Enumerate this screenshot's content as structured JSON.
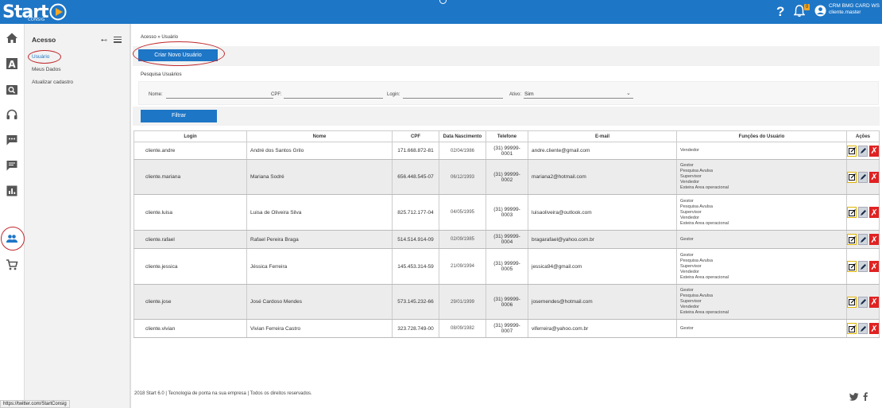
{
  "header": {
    "logo_text": "Start",
    "logo_sub": "CONSIG",
    "help_label": "?",
    "notification_count": "0",
    "user_company": "CRM BMG CARD WS",
    "user_login": "cliente.master",
    "brand_color": "#1e76c6"
  },
  "submenu": {
    "title": "Acesso",
    "items": [
      "Usuário",
      "Meus Dados",
      "Atualizar cadastro"
    ]
  },
  "status_url": "https://twitter.com/StartConsig",
  "breadcrumb": "Acesso » Usuário",
  "create_button": "Criar Novo Usuário",
  "search": {
    "title": "Pesquisa Usuários",
    "nome_label": "Nome:",
    "cpf_label": "CPF:",
    "login_label": "Login:",
    "ativo_label": "Ativo:",
    "ativo_value": "Sim",
    "filter_button": "Filtrar"
  },
  "table": {
    "headers": [
      "Login",
      "Nome",
      "CPF",
      "Data Nascimento",
      "Telefone",
      "E-mail",
      "Funções do Usuário",
      "Ações"
    ],
    "rows": [
      {
        "login": "cliente.andre",
        "nome": "André dos Santos Grilo",
        "cpf": "171.668.872-81",
        "nascimento": "02/04/1986",
        "telefone": "(31) 99999-0001",
        "email": "andre.cliente@gmail.com",
        "funcoes": [
          "Vendedor"
        ]
      },
      {
        "login": "cliente.mariana",
        "nome": "Mariana Sodré",
        "cpf": "656.448.545-07",
        "nascimento": "06/12/1993",
        "telefone": "(31) 99999-0002",
        "email": "mariana2@hotmail.com",
        "funcoes": [
          "Gestor",
          "Pesquisa Avulsa",
          "Supervisor",
          "Vendedor",
          "Esteira Area operacional"
        ]
      },
      {
        "login": "cliente.luisa",
        "nome": "Luisa de Oliveira Silva",
        "cpf": "825.712.177-04",
        "nascimento": "04/05/1995",
        "telefone": "(31) 99999-0003",
        "email": "luisaoliveira@outlook.com",
        "funcoes": [
          "Gestor",
          "Pesquisa Avulsa",
          "Supervisor",
          "Vendedor",
          "Esteira Area operacional"
        ]
      },
      {
        "login": "cliente.rafael",
        "nome": "Rafael Pereira Braga",
        "cpf": "514.514.914-09",
        "nascimento": "02/09/1985",
        "telefone": "(31) 99999-0004",
        "email": "bragarafael@yahoo.com.br",
        "funcoes": [
          "Gestor"
        ]
      },
      {
        "login": "cliente.jessica",
        "nome": "Jéssica Ferreira",
        "cpf": "145.453.314-59",
        "nascimento": "21/09/1994",
        "telefone": "(31) 99999-0005",
        "email": "jessica94@gmail.com",
        "funcoes": [
          "Gestor",
          "Pesquisa Avulsa",
          "Supervisor",
          "Vendedor",
          "Esteira Area operacional"
        ]
      },
      {
        "login": "cliente.jose",
        "nome": "José Cardoso Mendes",
        "cpf": "573.145.232-66",
        "nascimento": "29/01/1999",
        "telefone": "(31) 99999-0006",
        "email": "josemendes@hotmail.com",
        "funcoes": [
          "Gestor",
          "Pesquisa Avulsa",
          "Supervisor",
          "Vendedor",
          "Esteira Area operacional"
        ]
      },
      {
        "login": "cliente.vivian",
        "nome": "Vivian Ferreira Castro",
        "cpf": "323.728.749-00",
        "nascimento": "08/09/1982",
        "telefone": "(31) 99999-0007",
        "email": "viferreira@yahoo.com.br",
        "funcoes": [
          "Gestor"
        ]
      }
    ]
  },
  "footer": "2018 Start 6.0 | Tecnologia de ponta na sua empresa | Todos os direitos reservados.",
  "nav_icons": [
    "home-icon",
    "font-icon",
    "search-icon",
    "headset-icon",
    "chat-icon",
    "message-icon",
    "chart-icon",
    "users-icon",
    "cart-icon"
  ]
}
